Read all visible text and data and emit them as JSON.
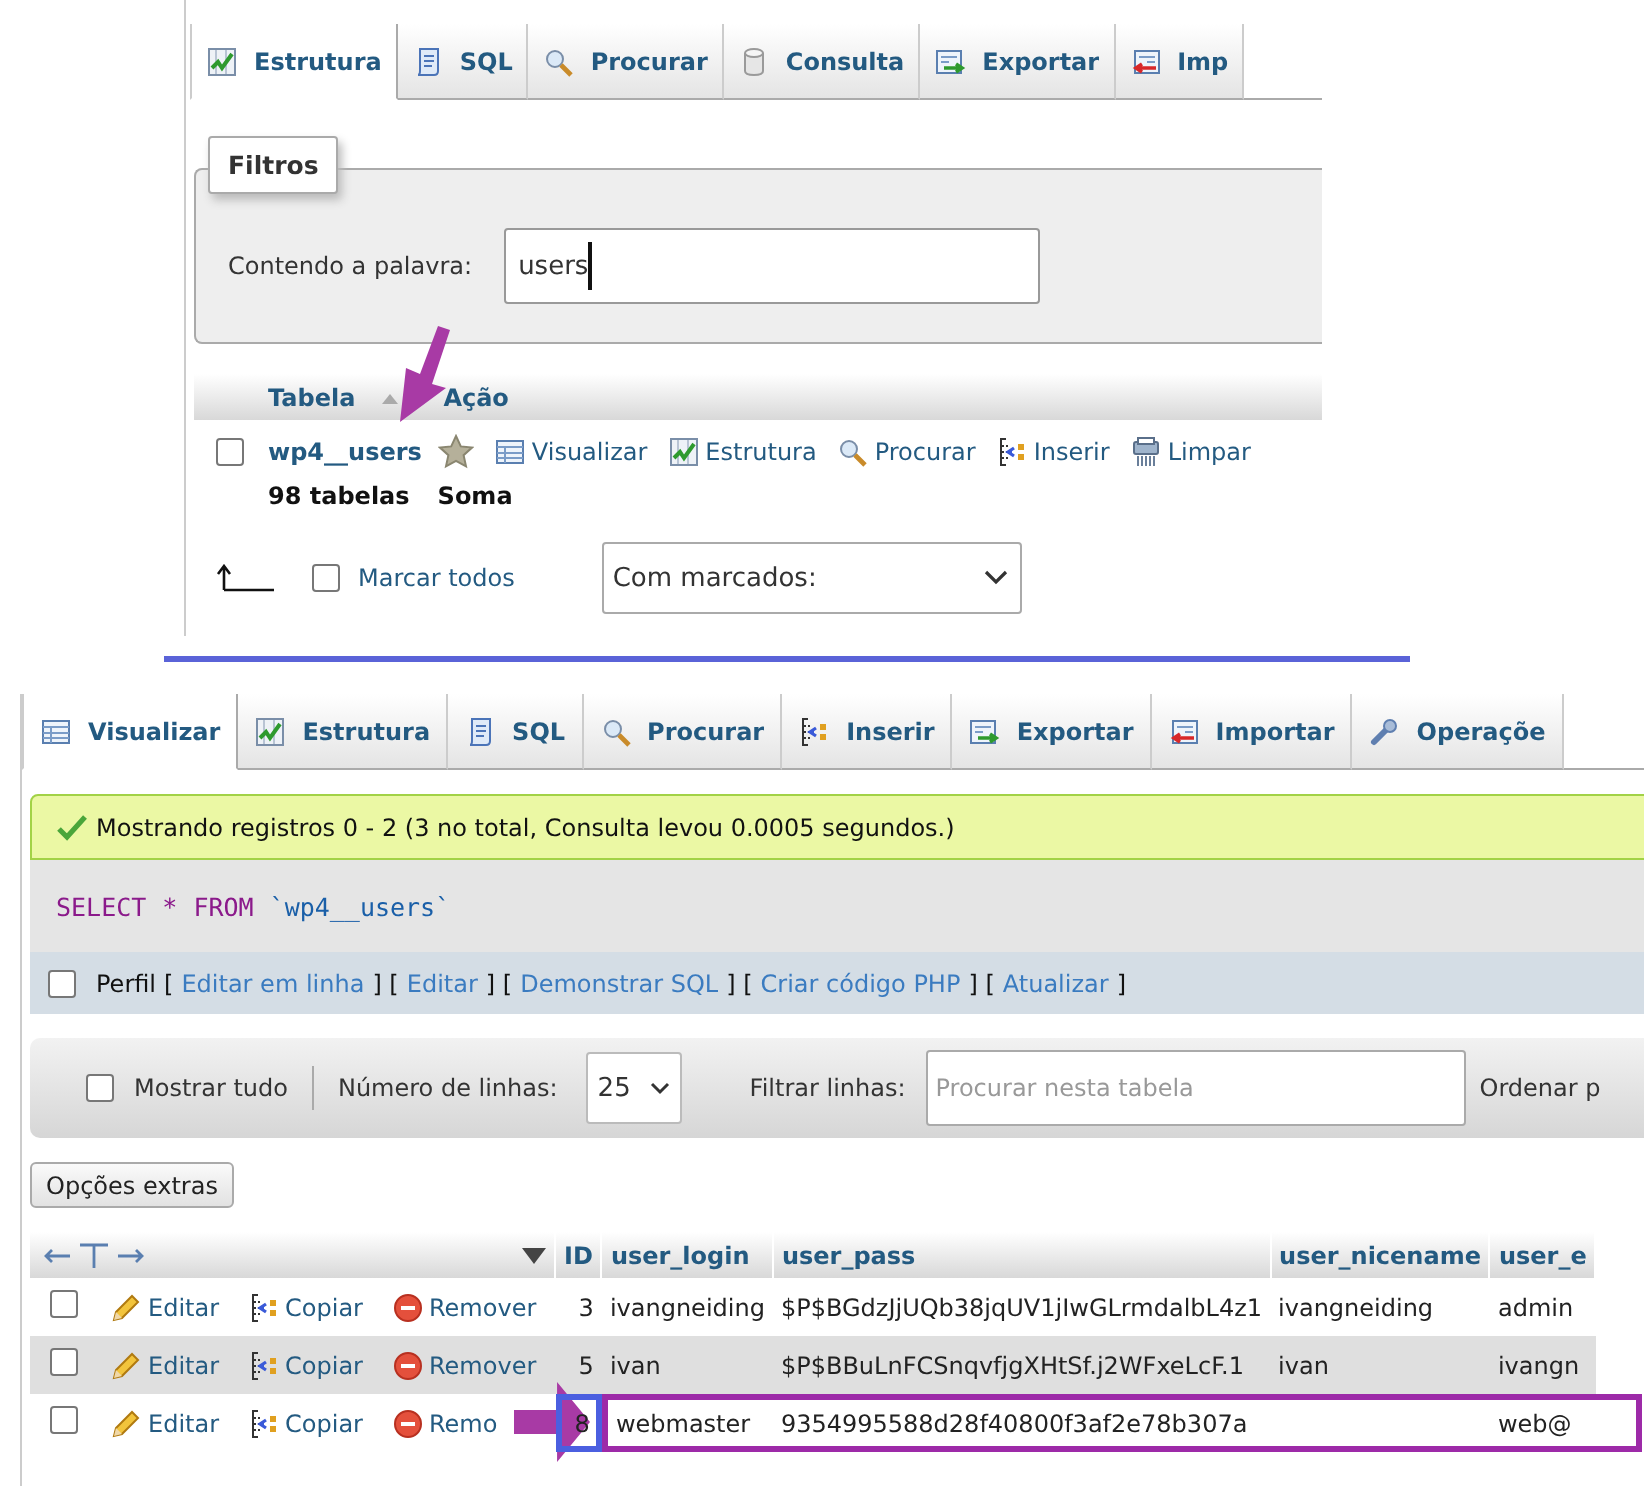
{
  "database_view": {
    "tabs": [
      {
        "label": "Estrutura",
        "kind": "structure",
        "selected": true
      },
      {
        "label": "SQL",
        "kind": "sql",
        "selected": false
      },
      {
        "label": "Procurar",
        "kind": "search",
        "selected": false
      },
      {
        "label": "Consulta",
        "kind": "query",
        "selected": false
      },
      {
        "label": "Exportar",
        "kind": "export",
        "selected": false
      },
      {
        "label": "Imp",
        "kind": "import",
        "selected": false
      }
    ],
    "filter": {
      "legend": "Filtros",
      "label": "Contendo a palavra:",
      "value": "users"
    },
    "table": {
      "columns": [
        "Tabela",
        "Ação"
      ],
      "rows": [
        {
          "name": "wp4__users",
          "checked": false,
          "favorite": false,
          "actions": [
            {
              "label": "Visualizar",
              "kind": "browse"
            },
            {
              "label": "Estrutura",
              "kind": "structure"
            },
            {
              "label": "Procurar",
              "kind": "search"
            },
            {
              "label": "Inserir",
              "kind": "insert"
            },
            {
              "label": "Limpar",
              "kind": "empty"
            }
          ]
        }
      ],
      "summary": [
        "98 tabelas",
        "Soma"
      ]
    },
    "check_all": {
      "label": "Marcar todos",
      "checked": false
    },
    "with_selected": "Com marcados:"
  },
  "browse_view": {
    "tabs": [
      {
        "label": "Visualizar",
        "kind": "browse",
        "selected": true
      },
      {
        "label": "Estrutura",
        "kind": "structure",
        "selected": false
      },
      {
        "label": "SQL",
        "kind": "sql",
        "selected": false
      },
      {
        "label": "Procurar",
        "kind": "search",
        "selected": false
      },
      {
        "label": "Inserir",
        "kind": "insert",
        "selected": false
      },
      {
        "label": "Exportar",
        "kind": "export",
        "selected": false
      },
      {
        "label": "Importar",
        "kind": "import",
        "selected": false
      },
      {
        "label": "Operaçõe",
        "kind": "operations",
        "selected": false
      }
    ],
    "message": "Mostrando registros 0 - 2 (3 no total, Consulta levou 0.0005 segundos.)",
    "query": [
      {
        "text": "SELECT",
        "kind": "keyword"
      },
      {
        "text": "*",
        "kind": "operator"
      },
      {
        "text": "FROM",
        "kind": "keyword"
      },
      {
        "text": "`wp4__users`",
        "kind": "identifier"
      }
    ],
    "profile": {
      "checked": false,
      "parts": [
        {
          "text": "Perfil",
          "kind": "text"
        },
        {
          "text": "[",
          "kind": "text"
        },
        {
          "text": "Editar em linha",
          "kind": "link"
        },
        {
          "text": "] [",
          "kind": "text"
        },
        {
          "text": "Editar",
          "kind": "link"
        },
        {
          "text": "] [",
          "kind": "text"
        },
        {
          "text": "Demonstrar SQL",
          "kind": "link"
        },
        {
          "text": "] [",
          "kind": "text"
        },
        {
          "text": "Criar código PHP",
          "kind": "link"
        },
        {
          "text": "] [",
          "kind": "text"
        },
        {
          "text": "Atualizar",
          "kind": "link"
        },
        {
          "text": "]",
          "kind": "text"
        }
      ]
    },
    "toolbar": {
      "show_all": {
        "label": "Mostrar tudo",
        "checked": false
      },
      "rows_label": "Número de linhas:",
      "rows_value": "25",
      "filter_label": "Filtrar linhas:",
      "filter_placeholder": "Procurar nesta tabela",
      "sort_label": "Ordenar p"
    },
    "extra_options": "Opções extras",
    "results": {
      "columns": [
        "ID",
        "user_login",
        "user_pass",
        "user_nicename",
        "user_e"
      ],
      "rows": [
        {
          "checked": false,
          "actions": [
            {
              "label": "Editar",
              "kind": "edit"
            },
            {
              "label": "Copiar",
              "kind": "copy"
            },
            {
              "label": "Remover",
              "kind": "delete"
            }
          ],
          "cells": [
            "3",
            "ivangneiding",
            "$P$BGdzJjUQb38jqUV1jIwGLrmdalbL4z1",
            "ivangneiding",
            "admin"
          ]
        },
        {
          "checked": false,
          "actions": [
            {
              "label": "Editar",
              "kind": "edit"
            },
            {
              "label": "Copiar",
              "kind": "copy"
            },
            {
              "label": "Remover",
              "kind": "delete"
            }
          ],
          "cells": [
            "5",
            "ivan",
            "$P$BBuLnFCSnqvfjgXHtSf.j2WFxeLcF.1",
            "ivan",
            "ivangn"
          ]
        },
        {
          "checked": false,
          "actions": [
            {
              "label": "Editar",
              "kind": "edit"
            },
            {
              "label": "Copiar",
              "kind": "copy"
            },
            {
              "label": "Remo",
              "kind": "delete"
            }
          ],
          "cells": [
            "8",
            "webmaster",
            "9354995588d28f40800f3af2e78b307a",
            "",
            "web@"
          ]
        }
      ]
    }
  },
  "annotations": [
    {
      "kind": "arrow",
      "color": "#a83aa5"
    },
    {
      "kind": "arrow",
      "color": "#a83aa5"
    },
    {
      "kind": "frame",
      "color": "#4b5fe0"
    },
    {
      "kind": "frame",
      "color": "#9d2aa8"
    }
  ]
}
